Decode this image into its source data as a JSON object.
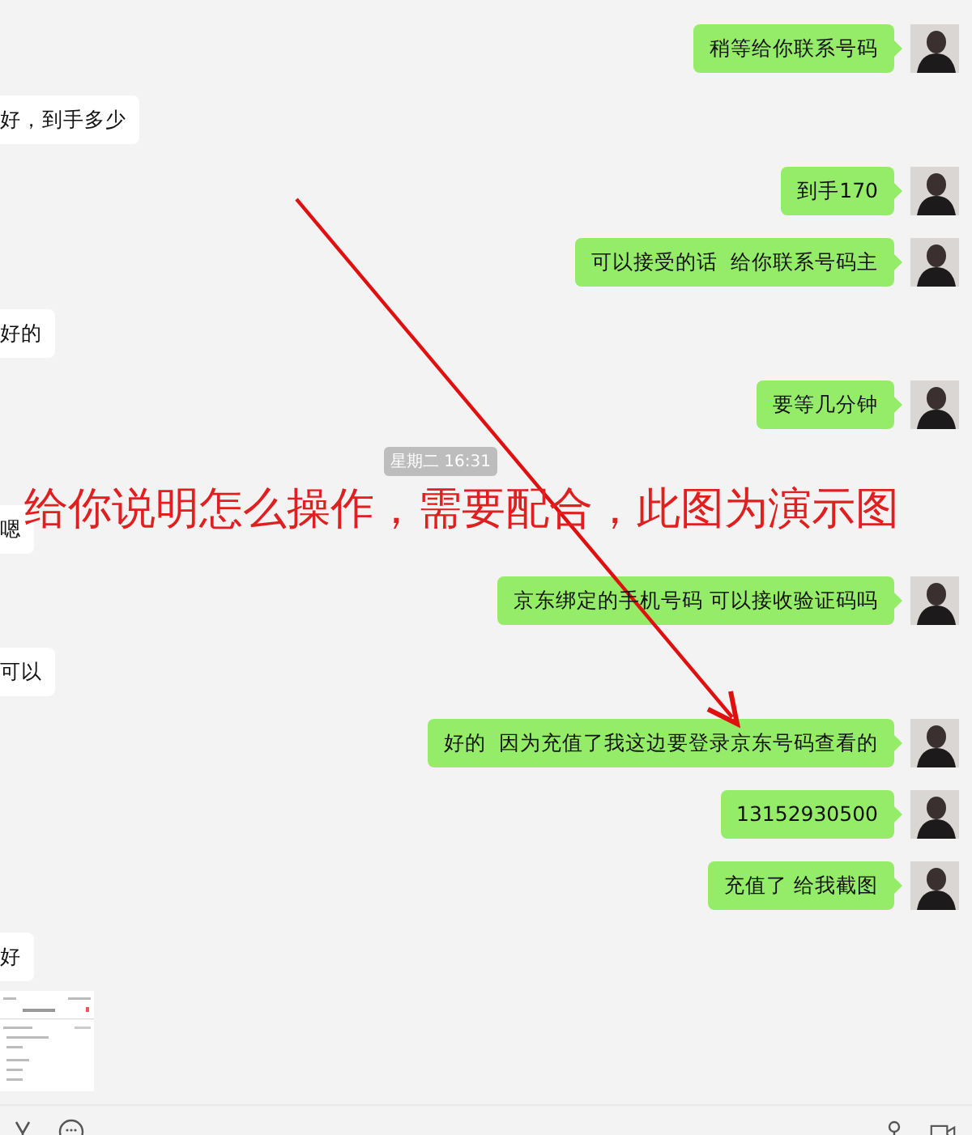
{
  "messages": [
    {
      "kind": "out",
      "text": "稍等给你联系号码"
    },
    {
      "kind": "in",
      "text": "好，到手多少"
    },
    {
      "kind": "out",
      "text": "到手170"
    },
    {
      "kind": "out",
      "text": "可以接受的话  给你联系号码主"
    },
    {
      "kind": "in",
      "text": "好的"
    },
    {
      "kind": "out",
      "text": "要等几分钟"
    },
    {
      "kind": "time",
      "text": "星期二 16:31"
    },
    {
      "kind": "in",
      "text": "嗯"
    },
    {
      "kind": "out",
      "text": "京东绑定的手机号码 可以接收验证码吗"
    },
    {
      "kind": "in",
      "text": "可以"
    },
    {
      "kind": "out",
      "text": "好的  因为充值了我这边要登录京东号码查看的"
    },
    {
      "kind": "out",
      "text": "13152930500"
    },
    {
      "kind": "out",
      "text": "充值了 给我截图"
    },
    {
      "kind": "in",
      "text": "好"
    },
    {
      "kind": "image"
    }
  ],
  "annotation": {
    "text": "给你说明怎么操作，需要配合，此图为演示图"
  }
}
